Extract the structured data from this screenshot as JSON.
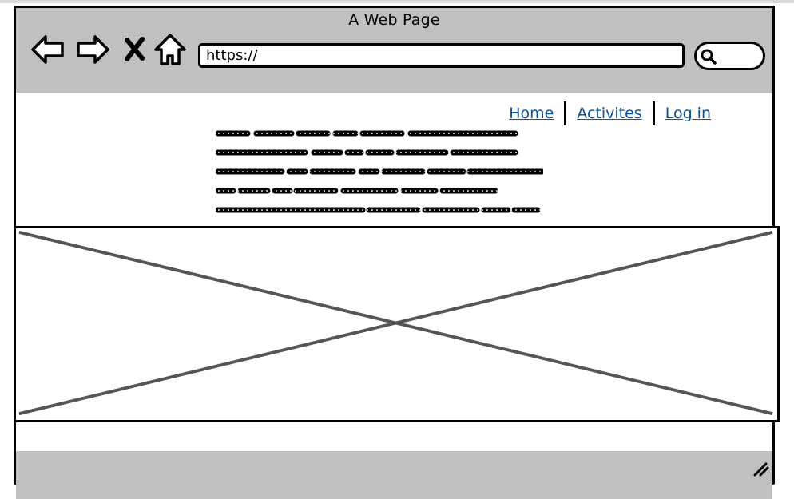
{
  "window": {
    "title": "A Web Page"
  },
  "toolbar": {
    "back_icon": "back-arrow-icon",
    "forward_icon": "forward-arrow-icon",
    "stop_icon": "close-icon",
    "home_icon": "home-icon",
    "url": "https://",
    "search_icon": "search-icon"
  },
  "nav": {
    "links": [
      "Home",
      "Activites",
      "Log in"
    ]
  },
  "colors": {
    "chrome": "#c0c0c0",
    "link": "#0b5394",
    "placeholder_x": "#555555"
  }
}
